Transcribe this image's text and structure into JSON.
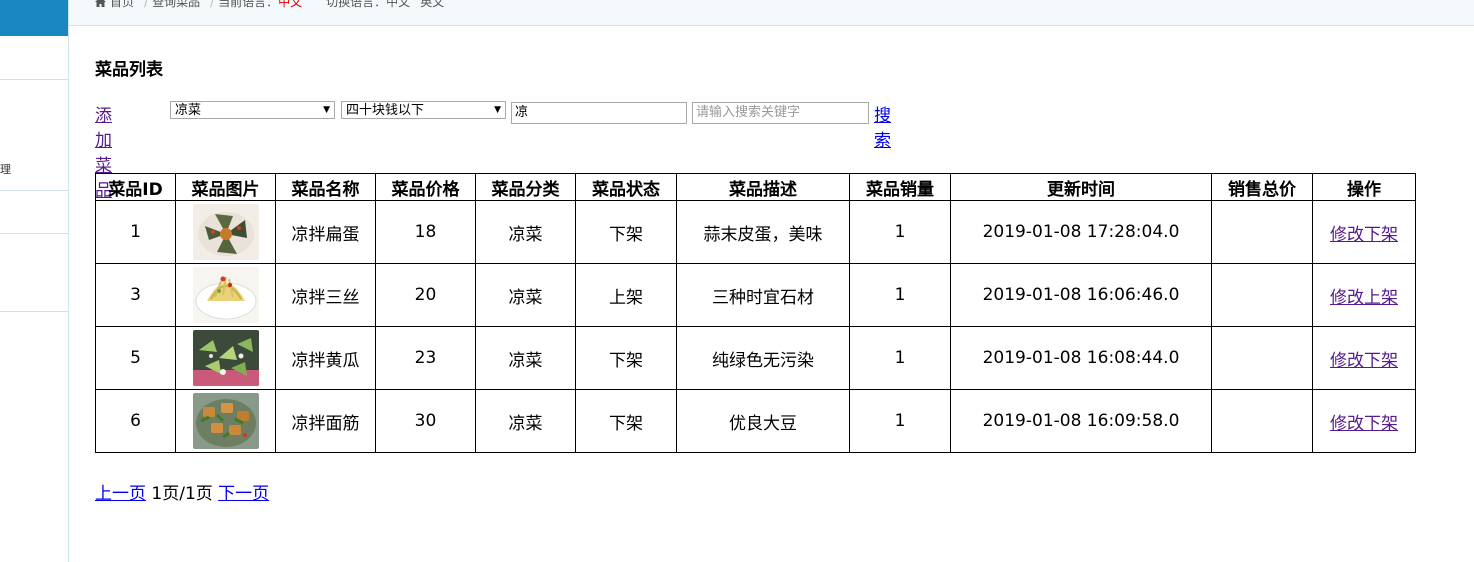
{
  "breadcrumb": {
    "home": "首页",
    "page": "查询菜品",
    "lang_label": "当前语言：",
    "lang_value": "中文",
    "switch_label": "切换语言：",
    "switch_cn": "中文",
    "switch_en": "英文"
  },
  "sidebar": {
    "fragment": "理"
  },
  "page": {
    "title": "菜品列表"
  },
  "toolbar": {
    "add_label": "添加菜品",
    "category_select": "凉菜",
    "price_select": "四十块钱以下",
    "keyword_value": "凉",
    "search_placeholder": "请输入搜索关键字",
    "search_label": "搜索"
  },
  "table": {
    "headers": [
      "菜品ID",
      "菜品图片",
      "菜品名称",
      "菜品价格",
      "菜品分类",
      "菜品状态",
      "菜品描述",
      "菜品销量",
      "更新时间",
      "销售总价",
      "操作"
    ],
    "rows": [
      {
        "id": "1",
        "name": "凉拌扁蛋",
        "price": "18",
        "category": "凉菜",
        "status": "下架",
        "desc": "蒜末皮蛋，美味",
        "sales": "1",
        "updated": "2019-01-08 17:28:04.0",
        "total": "",
        "edit": "修改",
        "toggle": "下架"
      },
      {
        "id": "3",
        "name": "凉拌三丝",
        "price": "20",
        "category": "凉菜",
        "status": "上架",
        "desc": "三种时宜石材",
        "sales": "1",
        "updated": "2019-01-08 16:06:46.0",
        "total": "",
        "edit": "修改",
        "toggle": "上架"
      },
      {
        "id": "5",
        "name": "凉拌黄瓜",
        "price": "23",
        "category": "凉菜",
        "status": "下架",
        "desc": "纯绿色无污染",
        "sales": "1",
        "updated": "2019-01-08 16:08:44.0",
        "total": "",
        "edit": "修改",
        "toggle": "下架"
      },
      {
        "id": "6",
        "name": "凉拌面筋",
        "price": "30",
        "category": "凉菜",
        "status": "下架",
        "desc": "优良大豆",
        "sales": "1",
        "updated": "2019-01-08 16:09:58.0",
        "total": "",
        "edit": "修改",
        "toggle": "下架"
      }
    ]
  },
  "pager": {
    "prev": "上一页",
    "info": "1页/1页",
    "next": "下一页"
  },
  "colors": {
    "brand": "#1a87c0",
    "link": "#551a8b",
    "link_blue": "#0000ee",
    "current_lang": "#e00000"
  }
}
